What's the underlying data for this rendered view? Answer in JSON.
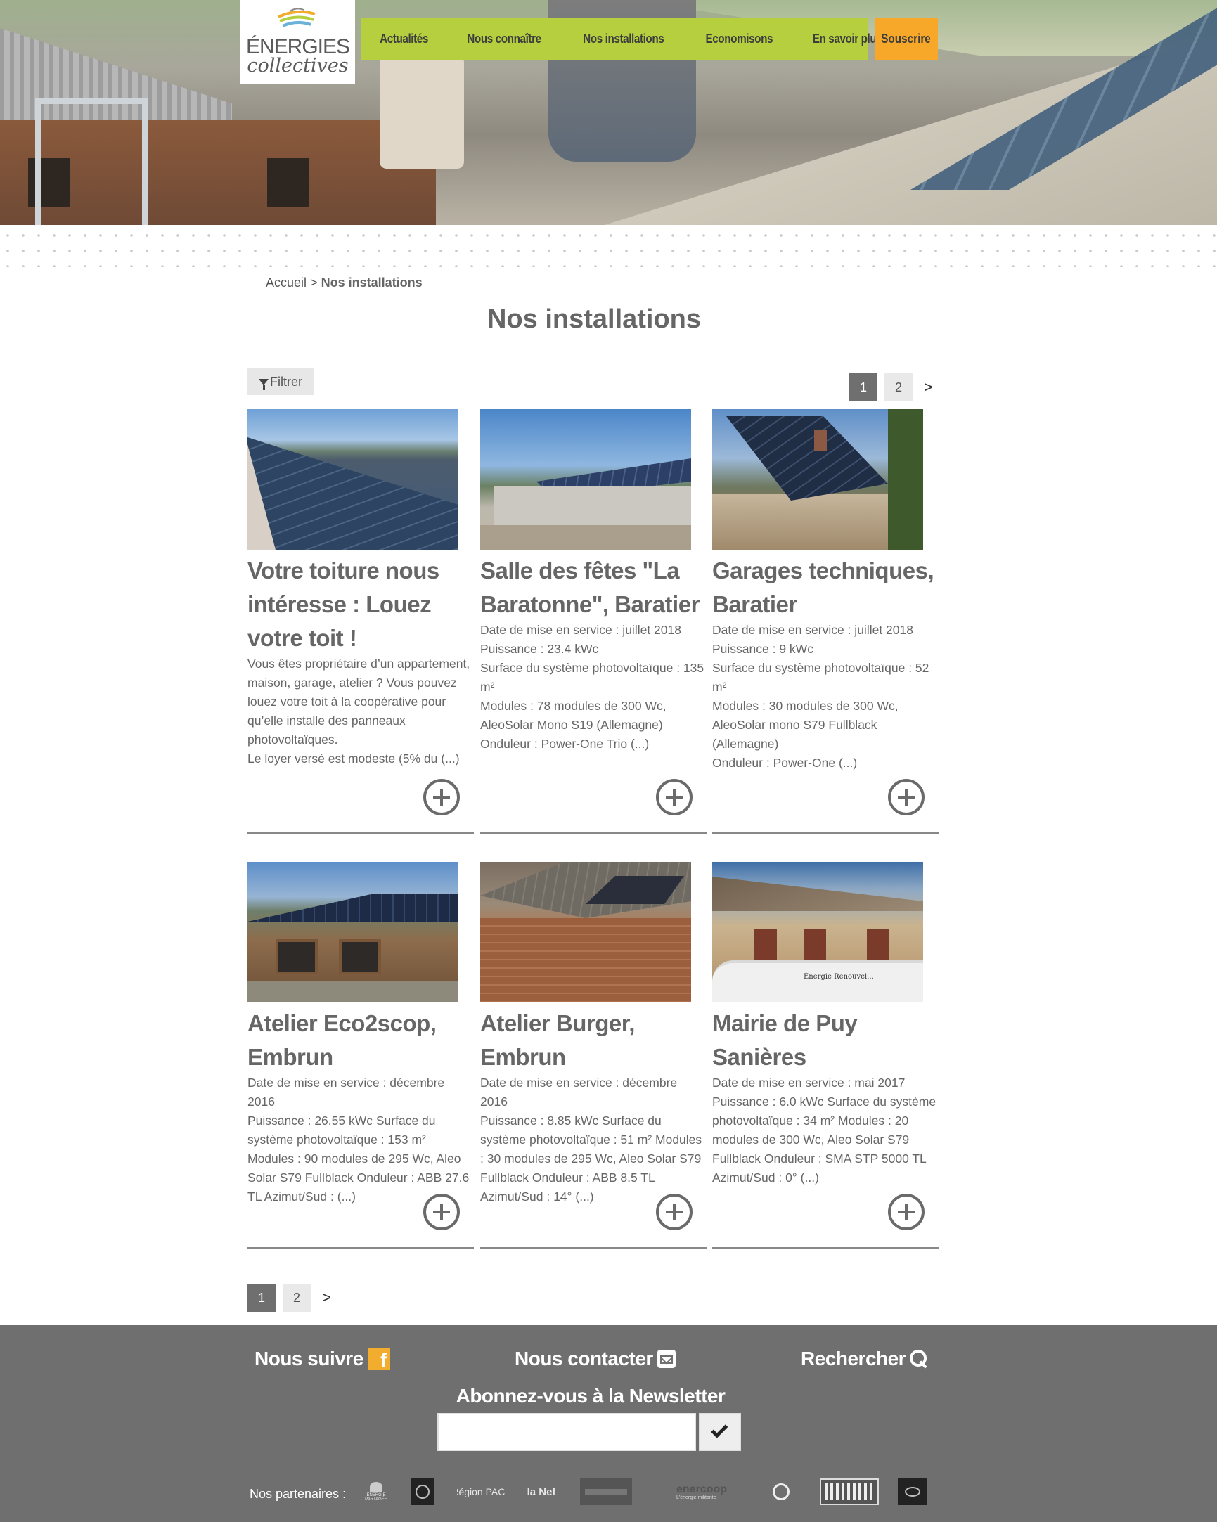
{
  "logo": {
    "line1": "ÉNERGIES",
    "line2": "collectives"
  },
  "nav": {
    "items": [
      "Actualités",
      "Nous connaître",
      "Nos installations",
      "Economisons",
      "En savoir plus"
    ],
    "subscribe": "Souscrire"
  },
  "colors": {
    "nav_bg": "#b5cf3f",
    "subscribe_bg": "#f7a829",
    "footer_bg": "#6f6f70",
    "facebook_icon": "#f3ad2e"
  },
  "breadcrumb": {
    "home": "Accueil",
    "separator": ">",
    "current": "Nos installations"
  },
  "page_title": "Nos installations",
  "filter": {
    "label": "Filtrer",
    "icon": "filter-icon"
  },
  "pagination": {
    "pages": [
      "1",
      "2"
    ],
    "active": "1",
    "next": ">"
  },
  "cards": [
    {
      "title": "Votre toiture nous intéresse : Louez votre toit !",
      "description": "Vous êtes propriétaire d’un appartement, maison, garage, atelier ? Vous pouvez louez votre toit à la coopérative pour qu’elle installe des panneaux photovoltaïques.\nLe loyer versé est modeste (5% du (...)"
    },
    {
      "title": "Salle des fêtes \"La Baratonne\", Baratier",
      "description": "Date de mise en service : juillet 2018\nPuissance : 23.4 kWc\nSurface du système photovoltaïque : 135 m²\nModules : 78 modules de 300 Wc, AleoSolar Mono S19 (Allemagne)\nOnduleur : Power-One Trio (...)"
    },
    {
      "title": "Garages techniques, Baratier",
      "description": "Date de mise en service : juillet 2018\nPuissance : 9 kWc\nSurface du système photovoltaïque : 52 m²\nModules : 30 modules de 300 Wc, AleoSolar mono S79 Fullblack (Allemagne)\nOnduleur : Power-One (...)"
    },
    {
      "title": "Atelier Eco2scop, Embrun",
      "description": "Date de mise en service : décembre 2016\nPuissance : 26.55 kWc Surface du système photovoltaïque : 153 m²\nModules : 90 modules de 295 Wc, Aleo Solar S79 Fullblack Onduleur : ABB 27.6 TL Azimut/Sud : (...)"
    },
    {
      "title": "Atelier Burger, Embrun",
      "description": "Date de mise en service : décembre 2016\nPuissance : 8.85 kWc Surface du système photovoltaïque : 51 m² Modules : 30 modules de 295 Wc, Aleo Solar S79 Fullblack Onduleur : ABB 8.5 TL Azimut/Sud : 14° (...)"
    },
    {
      "title": "Mairie de Puy Sanières",
      "description": "Date de mise en service : mai 2017\nPuissance : 6.0 kWc Surface du système photovoltaïque : 34 m² Modules : 20 modules de 300 Wc, Aleo Solar S79 Fullblack Onduleur : SMA STP 5000 TL Azimut/Sud : 0° (...)"
    }
  ],
  "thumbnail_text": {
    "van": "Énergie   Renouvel..."
  },
  "footer": {
    "follow": "Nous suivre",
    "facebook_glyph": "f",
    "contact": "Nous contacter",
    "search": "Rechercher",
    "newsletter_title": "Abonnez-vous à la Newsletter",
    "newsletter_placeholder": "",
    "partners_label": "Nos partenaires :",
    "partners": [
      "ÉNERGIE PARTAGÉE",
      "Région PACA",
      "la Nef",
      "enercoop",
      "L'énergie militante"
    ]
  }
}
